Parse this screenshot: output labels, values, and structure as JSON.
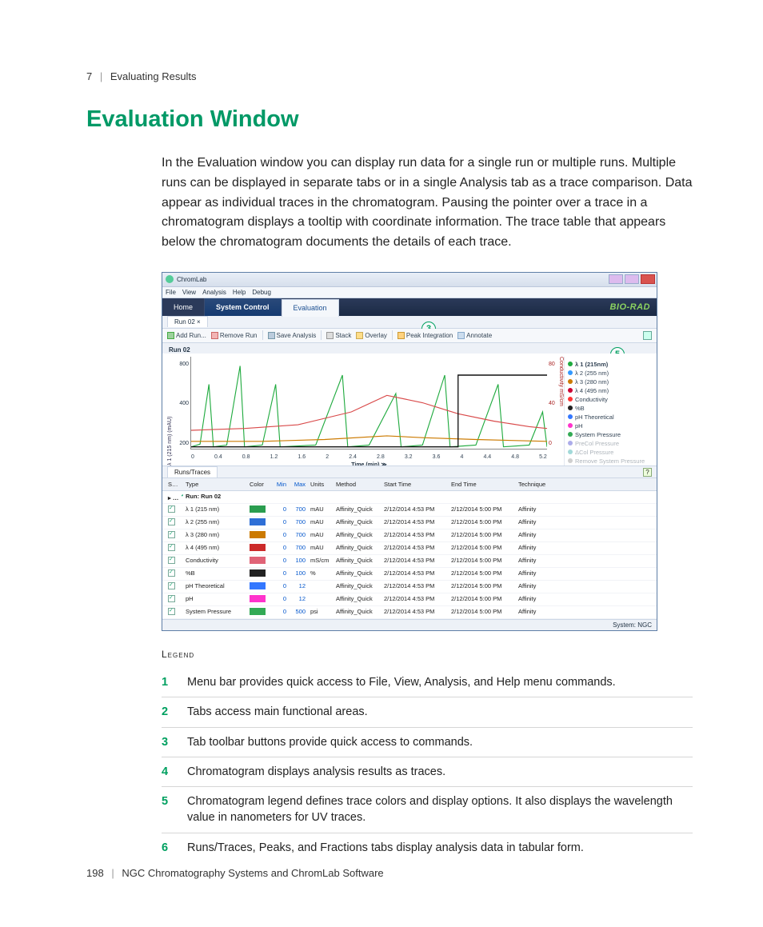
{
  "breadcrumb": {
    "chapter": "7",
    "title": "Evaluating Results"
  },
  "heading": "Evaluation Window",
  "intro": "In the Evaluation window you can display run data for a single run or multiple runs. Multiple runs can be displayed in separate tabs or in a single Analysis tab as a trace comparison. Data appear as individual traces in the chromatogram. Pausing the pointer over a trace in a chromatogram displays a tooltip with coordinate information. The trace table that appears below the chromatogram documents the details of each trace.",
  "app": {
    "title": "ChromLab",
    "menubar": [
      "File",
      "View",
      "Analysis",
      "Help",
      "Debug"
    ],
    "nav": {
      "home": "Home",
      "system": "System Control",
      "evaluation": "Evaluation",
      "brand": "BIO-RAD"
    },
    "run_tab": "Run 02  ×",
    "toolbar": {
      "add_run": "Add Run...",
      "remove_run": "Remove Run",
      "save_analysis": "Save Analysis",
      "stack": "Stack",
      "overlay": "Overlay",
      "peak_integration": "Peak Integration",
      "annotate": "Annotate"
    },
    "run_label": "Run 02",
    "chart": {
      "xlabel": "Time (min) ≫",
      "ylabel_left": "λ 1 (215 nm) (mAU)",
      "ylabel_right": "Conductivity mS/cm",
      "y_ticks_left": [
        "800",
        "400",
        "200"
      ],
      "y_ticks_right": [
        "80",
        "40",
        "0"
      ],
      "x_ticks": [
        "0",
        "0.4",
        "0.8",
        "1.2",
        "1.6",
        "2",
        "2.4",
        "2.8",
        "3.2",
        "3.6",
        "4",
        "4.4",
        "4.8",
        "5.2"
      ]
    },
    "chart_legend": {
      "header": "λ 1 (215nm)",
      "items": [
        {
          "label": "λ 2 (255 nm)",
          "color": "#3399ff"
        },
        {
          "label": "λ 3 (280 nm)",
          "color": "#cc7a00"
        },
        {
          "label": "λ 4 (495 nm)",
          "color": "#cc0033"
        },
        {
          "label": "Conductivity",
          "color": "#ff3333"
        },
        {
          "label": "%B",
          "color": "#222222"
        },
        {
          "label": "pH Theoretical",
          "color": "#3377ff"
        },
        {
          "label": "pH",
          "color": "#ff33cc"
        },
        {
          "label": "System Pressure",
          "color": "#33aa55"
        },
        {
          "label": "PreCol Pressure",
          "color": "#3333cc"
        },
        {
          "label": "ΔCol Pressure",
          "color": "#1aa3a3"
        },
        {
          "label": "Remove System Pressure",
          "color": "#888888"
        }
      ]
    },
    "traces_tab": "Runs/Traces",
    "table": {
      "headers": [
        "Show",
        "Type",
        "Color",
        "Min",
        "Max",
        "Units",
        "Method",
        "Start Time",
        "End Time",
        "Technique"
      ],
      "title_row": "Run: Run 02",
      "rows": [
        {
          "type": "λ 1 (215 nm)",
          "color": "#2a9d4f",
          "min": "0",
          "max": "700",
          "units": "mAU",
          "method": "Affinity_Quick",
          "start": "2/12/2014 4:53 PM",
          "end": "2/12/2014 5:00 PM",
          "tech": "Affinity"
        },
        {
          "type": "λ 2 (255 nm)",
          "color": "#2e6fd6",
          "min": "0",
          "max": "700",
          "units": "mAU",
          "method": "Affinity_Quick",
          "start": "2/12/2014 4:53 PM",
          "end": "2/12/2014 5:00 PM",
          "tech": "Affinity"
        },
        {
          "type": "λ 3 (280 nm)",
          "color": "#cc7a00",
          "min": "0",
          "max": "700",
          "units": "mAU",
          "method": "Affinity_Quick",
          "start": "2/12/2014 4:53 PM",
          "end": "2/12/2014 5:00 PM",
          "tech": "Affinity"
        },
        {
          "type": "λ 4 (495 nm)",
          "color": "#cc2a2a",
          "min": "0",
          "max": "700",
          "units": "mAU",
          "method": "Affinity_Quick",
          "start": "2/12/2014 4:53 PM",
          "end": "2/12/2014 5:00 PM",
          "tech": "Affinity"
        },
        {
          "type": "Conductivity",
          "color": "#e06377",
          "min": "0",
          "max": "100",
          "units": "mS/cm",
          "method": "Affinity_Quick",
          "start": "2/12/2014 4:53 PM",
          "end": "2/12/2014 5:00 PM",
          "tech": "Affinity"
        },
        {
          "type": "%B",
          "color": "#222222",
          "min": "0",
          "max": "100",
          "units": "%",
          "method": "Affinity_Quick",
          "start": "2/12/2014 4:53 PM",
          "end": "2/12/2014 5:00 PM",
          "tech": "Affinity"
        },
        {
          "type": "pH Theoretical",
          "color": "#3377ff",
          "min": "0",
          "max": "12",
          "units": "",
          "method": "Affinity_Quick",
          "start": "2/12/2014 4:53 PM",
          "end": "2/12/2014 5:00 PM",
          "tech": "Affinity"
        },
        {
          "type": "pH",
          "color": "#ff33cc",
          "min": "0",
          "max": "12",
          "units": "",
          "method": "Affinity_Quick",
          "start": "2/12/2014 4:53 PM",
          "end": "2/12/2014 5:00 PM",
          "tech": "Affinity"
        },
        {
          "type": "System Pressure",
          "color": "#33aa55",
          "min": "0",
          "max": "500",
          "units": "psi",
          "method": "Affinity_Quick",
          "start": "2/12/2014 4:53 PM",
          "end": "2/12/2014 5:00 PM",
          "tech": "Affinity"
        }
      ]
    },
    "statusbar": "System: NGC"
  },
  "legend_caption": "Legend",
  "legend_items": [
    {
      "n": "1",
      "text": "Menu bar provides quick access to File, View, Analysis, and Help menu commands."
    },
    {
      "n": "2",
      "text": "Tabs access main functional areas."
    },
    {
      "n": "3",
      "text": "Tab toolbar buttons provide quick access to commands."
    },
    {
      "n": "4",
      "text": "Chromatogram displays analysis results as traces."
    },
    {
      "n": "5",
      "text": "Chromatogram legend defines trace colors and display options. It also displays the wavelength value in nanometers for UV traces."
    },
    {
      "n": "6",
      "text": "Runs/Traces, Peaks, and Fractions tabs display analysis data in tabular form."
    }
  ],
  "footer": {
    "page": "198",
    "title": "NGC Chromatography Systems and ChromLab Software"
  }
}
